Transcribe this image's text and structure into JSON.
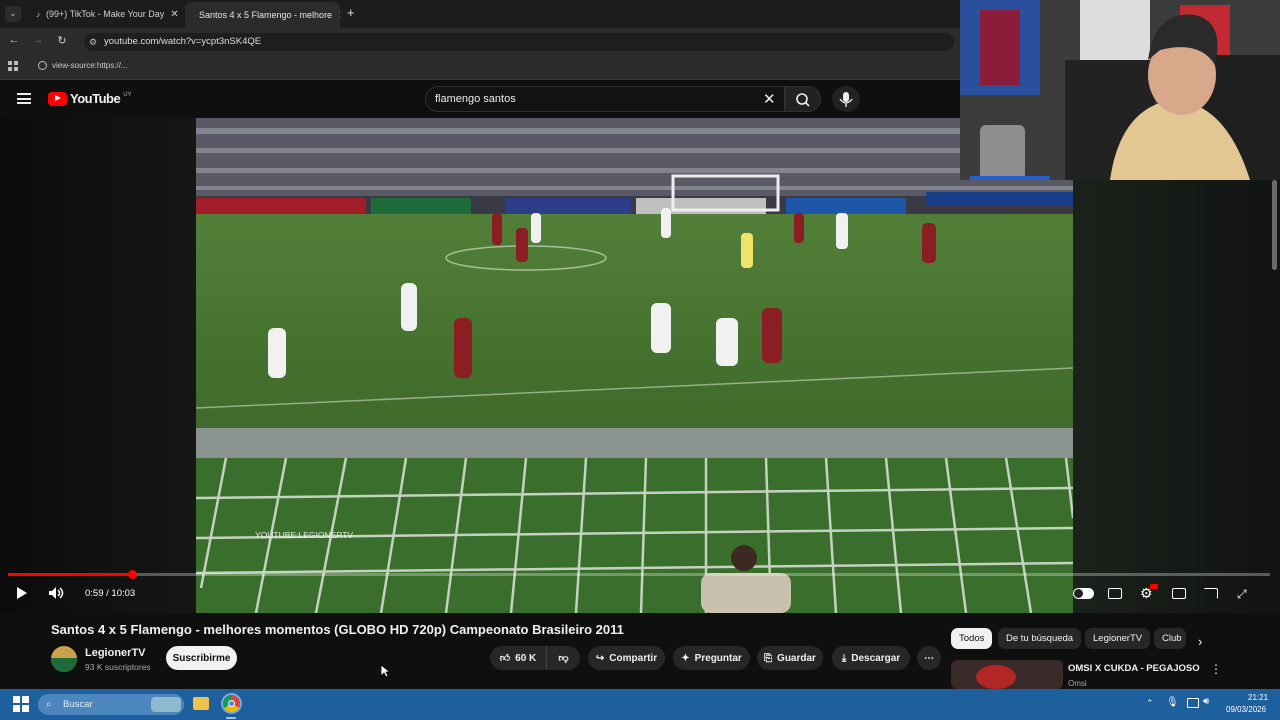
{
  "browser": {
    "tabs": [
      {
        "label": "(99+) TikTok - Make Your Day",
        "close": "✕"
      },
      {
        "label": "Santos 4 x 5 Flamengo - melhore",
        "close": "✕"
      }
    ],
    "new_tab": "+",
    "url": "youtube.com/watch?v=ycpt3nSK4QE",
    "bookmark": "view-source:https://..."
  },
  "youtube": {
    "logo_text": "YouTube",
    "country": "UY",
    "search_value": "flamengo santos"
  },
  "player": {
    "watermark": "YOUTUBE:LEGIONERTV",
    "time": "0:59 / 10:03",
    "progress_fraction": 0.098
  },
  "video_info": {
    "title": "Santos 4 x 5 Flamengo - melhores momentos (GLOBO HD 720p) Campeonato Brasileiro 2011",
    "channel": "LegionerTV",
    "subscribers": "93 K suscriptores",
    "subscribe": "Suscribirme",
    "likes": "60 K",
    "share": "Compartir",
    "ask": "Preguntar",
    "save": "Guardar",
    "download": "Descargar"
  },
  "chips": [
    "Todos",
    "De tu búsqueda",
    "LegionerTV",
    "Club"
  ],
  "recommended": {
    "title": "OMSI X CUKDA - PEGAJOSO",
    "channel": "Omsi"
  },
  "taskbar": {
    "search_placeholder": "Buscar",
    "time": "21:21",
    "date": "09/03/2026"
  },
  "colors": {
    "accent": "#ff0000",
    "taskbar": "#1e5f9e",
    "background": "#0f0f0f"
  }
}
